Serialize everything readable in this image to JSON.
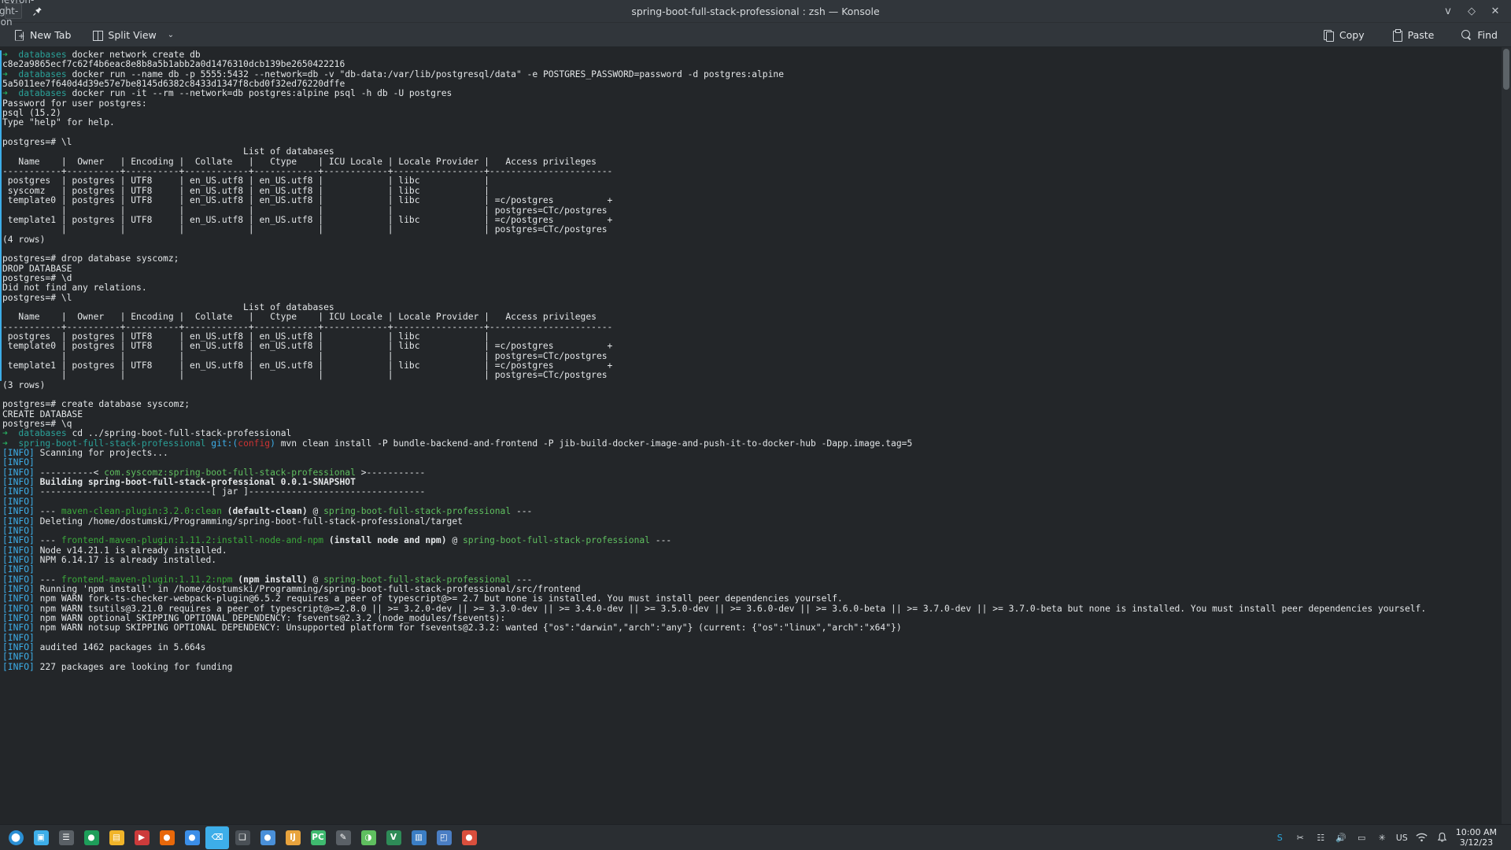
{
  "window": {
    "title": "spring-boot-full-stack-professional : zsh — Konsole",
    "menu_icon": "chevron-right-icon",
    "pin_icon": "pin-icon",
    "minimize_icon": "v",
    "maximize_icon": "◇",
    "close_icon": "✕"
  },
  "toolbar": {
    "new_tab": "New Tab",
    "split_view": "Split View",
    "split_chevron": "⌄",
    "copy": "Copy",
    "paste": "Paste",
    "find": "Find"
  },
  "terminal": {
    "lines": [
      [
        {
          "t": "➜ ",
          "c": "c-grn"
        },
        {
          "t": " databases ",
          "c": "c-cyan"
        },
        {
          "t": "docker network create db",
          "c": "c-w"
        }
      ],
      [
        {
          "t": "c8e2a9865ecf7c62f4b6eac8e8b8a5b1abb2a0d1476310dcb139be2650422216",
          "c": "c-w"
        }
      ],
      [
        {
          "t": "➜ ",
          "c": "c-grn"
        },
        {
          "t": " databases ",
          "c": "c-cyan"
        },
        {
          "t": "docker run --name db -p 5555:5432 --network=db -v \"db-data:/var/lib/postgresql/data\" -e POSTGRES_PASSWORD=password -d postgres:alpine",
          "c": "c-w"
        }
      ],
      [
        {
          "t": "5a5011ee7f640d4d39e57e7be8145d6382c8433d1347f8cbd0f32ed76220dffe",
          "c": "c-w"
        }
      ],
      [
        {
          "t": "➜ ",
          "c": "c-grn"
        },
        {
          "t": " databases ",
          "c": "c-cyan"
        },
        {
          "t": "docker run -it --rm --network=db postgres:alpine psql -h db -U postgres",
          "c": "c-w"
        }
      ],
      [
        {
          "t": "Password for user postgres:",
          "c": "c-w"
        }
      ],
      [
        {
          "t": "psql (15.2)",
          "c": "c-w"
        }
      ],
      [
        {
          "t": "Type \"help\" for help.",
          "c": "c-w"
        }
      ],
      [
        {
          "t": "",
          "c": "c-w"
        }
      ],
      [
        {
          "t": "postgres=# \\l",
          "c": "c-w"
        }
      ],
      [
        {
          "t": "                                             List of databases",
          "c": "c-w"
        }
      ],
      [
        {
          "t": "   Name    |  Owner   | Encoding |  Collate   |   Ctype    | ICU Locale | Locale Provider |   Access privileges",
          "c": "c-w"
        }
      ],
      [
        {
          "t": "-----------+----------+----------+------------+------------+------------+-----------------+-----------------------",
          "c": "c-w"
        }
      ],
      [
        {
          "t": " postgres  | postgres | UTF8     | en_US.utf8 | en_US.utf8 |            | libc            |",
          "c": "c-w"
        }
      ],
      [
        {
          "t": " syscomz   | postgres | UTF8     | en_US.utf8 | en_US.utf8 |            | libc            |",
          "c": "c-w"
        }
      ],
      [
        {
          "t": " template0 | postgres | UTF8     | en_US.utf8 | en_US.utf8 |            | libc            | =c/postgres          +",
          "c": "c-w"
        }
      ],
      [
        {
          "t": "           |          |          |            |            |            |                 | postgres=CTc/postgres",
          "c": "c-w"
        }
      ],
      [
        {
          "t": " template1 | postgres | UTF8     | en_US.utf8 | en_US.utf8 |            | libc            | =c/postgres          +",
          "c": "c-w"
        }
      ],
      [
        {
          "t": "           |          |          |            |            |            |                 | postgres=CTc/postgres",
          "c": "c-w"
        }
      ],
      [
        {
          "t": "(4 rows)",
          "c": "c-w"
        }
      ],
      [
        {
          "t": "",
          "c": "c-w"
        }
      ],
      [
        {
          "t": "postgres=# drop database syscomz;",
          "c": "c-w"
        }
      ],
      [
        {
          "t": "DROP DATABASE",
          "c": "c-w"
        }
      ],
      [
        {
          "t": "postgres=# \\d",
          "c": "c-w"
        }
      ],
      [
        {
          "t": "Did not find any relations.",
          "c": "c-w"
        }
      ],
      [
        {
          "t": "postgres=# \\l",
          "c": "c-w"
        }
      ],
      [
        {
          "t": "                                             List of databases",
          "c": "c-w"
        }
      ],
      [
        {
          "t": "   Name    |  Owner   | Encoding |  Collate   |   Ctype    | ICU Locale | Locale Provider |   Access privileges",
          "c": "c-w"
        }
      ],
      [
        {
          "t": "-----------+----------+----------+------------+------------+------------+-----------------+-----------------------",
          "c": "c-w"
        }
      ],
      [
        {
          "t": " postgres  | postgres | UTF8     | en_US.utf8 | en_US.utf8 |            | libc            |",
          "c": "c-w"
        }
      ],
      [
        {
          "t": " template0 | postgres | UTF8     | en_US.utf8 | en_US.utf8 |            | libc            | =c/postgres          +",
          "c": "c-w"
        }
      ],
      [
        {
          "t": "           |          |          |            |            |            |                 | postgres=CTc/postgres",
          "c": "c-w"
        }
      ],
      [
        {
          "t": " template1 | postgres | UTF8     | en_US.utf8 | en_US.utf8 |            | libc            | =c/postgres          +",
          "c": "c-w"
        }
      ],
      [
        {
          "t": "           |          |          |            |            |            |                 | postgres=CTc/postgres",
          "c": "c-w"
        }
      ],
      [
        {
          "t": "(3 rows)",
          "c": "c-w"
        }
      ],
      [
        {
          "t": "",
          "c": "c-w"
        }
      ],
      [
        {
          "t": "postgres=# create database syscomz;",
          "c": "c-w"
        }
      ],
      [
        {
          "t": "CREATE DATABASE",
          "c": "c-w"
        }
      ],
      [
        {
          "t": "postgres=# \u001f\\q",
          "c": "c-w"
        }
      ],
      [
        {
          "t": "➜ ",
          "c": "c-grn"
        },
        {
          "t": " databases ",
          "c": "c-cyan"
        },
        {
          "t": "cd ../spring-boot-full-stack-professional",
          "c": "c-w"
        }
      ],
      [
        {
          "t": "➜ ",
          "c": "c-grn"
        },
        {
          "t": " spring-boot-full-stack-professional ",
          "c": "c-cyan"
        },
        {
          "t": "git:(",
          "c": "c-blue"
        },
        {
          "t": "config",
          "c": "c-red"
        },
        {
          "t": ") ",
          "c": "c-blue"
        },
        {
          "t": "mvn clean install -P bundle-backend-and-frontend -P jib-build-docker-image-and-push-it-to-docker-hub -Dapp.image.tag=5",
          "c": "c-w"
        }
      ],
      [
        {
          "t": "[INFO]",
          "c": "c-blue"
        },
        {
          "t": " Scanning for projects...",
          "c": "c-w"
        }
      ],
      [
        {
          "t": "[INFO]",
          "c": "c-blue"
        },
        {
          "t": "",
          "c": "c-w"
        }
      ],
      [
        {
          "t": "[INFO]",
          "c": "c-blue"
        },
        {
          "t": " ----------< ",
          "c": "c-w"
        },
        {
          "t": "com.syscomz:spring-boot-full-stack-professional",
          "c": "c-gr3"
        },
        {
          "t": " >-----------",
          "c": "c-w"
        }
      ],
      [
        {
          "t": "[INFO]",
          "c": "c-blue"
        },
        {
          "t": " Building spring-boot-full-stack-professional 0.0.1-SNAPSHOT",
          "c": "c-w bold"
        }
      ],
      [
        {
          "t": "[INFO]",
          "c": "c-blue"
        },
        {
          "t": " --------------------------------[ jar ]---------------------------------",
          "c": "c-w"
        }
      ],
      [
        {
          "t": "[INFO]",
          "c": "c-blue"
        },
        {
          "t": "",
          "c": "c-w"
        }
      ],
      [
        {
          "t": "[INFO]",
          "c": "c-blue"
        },
        {
          "t": " --- ",
          "c": "c-w"
        },
        {
          "t": "maven-clean-plugin:3.2.0:clean",
          "c": "c-gr2"
        },
        {
          "t": " (default-clean)",
          "c": "c-w bold"
        },
        {
          "t": " @ ",
          "c": "c-w"
        },
        {
          "t": "spring-boot-full-stack-professional",
          "c": "c-gr3"
        },
        {
          "t": " ---",
          "c": "c-w"
        }
      ],
      [
        {
          "t": "[INFO]",
          "c": "c-blue"
        },
        {
          "t": " Deleting /home/dostumski/Programming/spring-boot-full-stack-professional/target",
          "c": "c-w"
        }
      ],
      [
        {
          "t": "[INFO]",
          "c": "c-blue"
        },
        {
          "t": "",
          "c": "c-w"
        }
      ],
      [
        {
          "t": "[INFO]",
          "c": "c-blue"
        },
        {
          "t": " --- ",
          "c": "c-w"
        },
        {
          "t": "frontend-maven-plugin:1.11.2:install-node-and-npm",
          "c": "c-gr2"
        },
        {
          "t": " (install node and npm)",
          "c": "c-w bold"
        },
        {
          "t": " @ ",
          "c": "c-w"
        },
        {
          "t": "spring-boot-full-stack-professional",
          "c": "c-gr3"
        },
        {
          "t": " ---",
          "c": "c-w"
        }
      ],
      [
        {
          "t": "[INFO]",
          "c": "c-blue"
        },
        {
          "t": " Node v14.21.1 is already installed.",
          "c": "c-w"
        }
      ],
      [
        {
          "t": "[INFO]",
          "c": "c-blue"
        },
        {
          "t": " NPM 6.14.17 is already installed.",
          "c": "c-w"
        }
      ],
      [
        {
          "t": "[INFO]",
          "c": "c-blue"
        },
        {
          "t": "",
          "c": "c-w"
        }
      ],
      [
        {
          "t": "[INFO]",
          "c": "c-blue"
        },
        {
          "t": " --- ",
          "c": "c-w"
        },
        {
          "t": "frontend-maven-plugin:1.11.2:npm",
          "c": "c-gr2"
        },
        {
          "t": " (npm install)",
          "c": "c-w bold"
        },
        {
          "t": " @ ",
          "c": "c-w"
        },
        {
          "t": "spring-boot-full-stack-professional",
          "c": "c-gr3"
        },
        {
          "t": " ---",
          "c": "c-w"
        }
      ],
      [
        {
          "t": "[INFO]",
          "c": "c-blue"
        },
        {
          "t": " Running 'npm install' in /home/dostumski/Programming/spring-boot-full-stack-professional/src/frontend",
          "c": "c-w"
        }
      ],
      [
        {
          "t": "[INFO]",
          "c": "c-blue"
        },
        {
          "t": " npm WARN fork-ts-checker-webpack-plugin@6.5.2 requires a peer of typescript@>= 2.7 but none is installed. You must install peer dependencies yourself.",
          "c": "c-w"
        }
      ],
      [
        {
          "t": "[INFO]",
          "c": "c-blue"
        },
        {
          "t": " npm WARN tsutils@3.21.0 requires a peer of typescript@>=2.8.0 || >= 3.2.0-dev || >= 3.3.0-dev || >= 3.4.0-dev || >= 3.5.0-dev || >= 3.6.0-dev || >= 3.6.0-beta || >= 3.7.0-dev || >= 3.7.0-beta but none is installed. You must install peer dependencies yourself.",
          "c": "c-w"
        }
      ],
      [
        {
          "t": "[INFO]",
          "c": "c-blue"
        },
        {
          "t": " npm WARN optional SKIPPING OPTIONAL DEPENDENCY: fsevents@2.3.2 (node_modules/fsevents):",
          "c": "c-w"
        }
      ],
      [
        {
          "t": "[INFO]",
          "c": "c-blue"
        },
        {
          "t": " npm WARN notsup SKIPPING OPTIONAL DEPENDENCY: Unsupported platform for fsevents@2.3.2: wanted {\"os\":\"darwin\",\"arch\":\"any\"} (current: {\"os\":\"linux\",\"arch\":\"x64\"})",
          "c": "c-w"
        }
      ],
      [
        {
          "t": "[INFO]",
          "c": "c-blue"
        },
        {
          "t": "",
          "c": "c-w"
        }
      ],
      [
        {
          "t": "[INFO]",
          "c": "c-blue"
        },
        {
          "t": " audited 1462 packages in 5.664s",
          "c": "c-w"
        }
      ],
      [
        {
          "t": "[INFO]",
          "c": "c-blue"
        },
        {
          "t": "",
          "c": "c-w"
        }
      ],
      [
        {
          "t": "[INFO]",
          "c": "c-blue"
        },
        {
          "t": " 227 packages are looking for funding",
          "c": "c-w"
        }
      ]
    ]
  },
  "taskbar": {
    "launcher": {
      "name": "application-launcher",
      "glyph": "⬤",
      "color": "#2a8fd4"
    },
    "items": [
      {
        "name": "pager",
        "glyph": "▣",
        "color": "#3daee9"
      },
      {
        "name": "file-manager",
        "glyph": "☰",
        "color": "#5a6066"
      },
      {
        "name": "web-browser",
        "glyph": "●",
        "color": "#1e9e5a"
      },
      {
        "name": "file-explorer",
        "glyph": "▤",
        "color": "#f0b429"
      },
      {
        "name": "media-player",
        "glyph": "▶",
        "color": "#cc3b3b"
      },
      {
        "name": "firefox",
        "glyph": "●",
        "color": "#e8680a"
      },
      {
        "name": "chrome",
        "glyph": "●",
        "color": "#3b8ee8"
      },
      {
        "name": "konsole",
        "glyph": "⌫",
        "color": "#3daee9"
      },
      {
        "name": "window-list",
        "glyph": "❑",
        "color": "#4a5056"
      },
      {
        "name": "chromium",
        "glyph": "●",
        "color": "#4a90d9"
      },
      {
        "name": "intellij-idea",
        "glyph": "IJ",
        "color": "#e8a33d"
      },
      {
        "name": "pycharm",
        "glyph": "PC",
        "color": "#3fba6f"
      },
      {
        "name": "text-editor",
        "glyph": "✎",
        "color": "#5a6066"
      },
      {
        "name": "node-app",
        "glyph": "◑",
        "color": "#5fbf5f"
      },
      {
        "name": "vim",
        "glyph": "V",
        "color": "#2e8b57"
      },
      {
        "name": "database-tool",
        "glyph": "▥",
        "color": "#3b7ec4"
      },
      {
        "name": "charts-app",
        "glyph": "◰",
        "color": "#4a7ec4"
      },
      {
        "name": "browser-alt",
        "glyph": "●",
        "color": "#d94f3d"
      }
    ],
    "tray": [
      {
        "name": "skype-tray-icon",
        "glyph": "S",
        "color": "#2aa9e0"
      },
      {
        "name": "clipboard-tray-icon",
        "glyph": "✂",
        "color": "#d2d7db"
      },
      {
        "name": "notes-tray-icon",
        "glyph": "☷",
        "color": "#d2d7db"
      },
      {
        "name": "volume-tray-icon",
        "glyph": "🔊",
        "color": "#d2d7db"
      },
      {
        "name": "battery-tray-icon",
        "glyph": "▭",
        "color": "#d2d7db"
      },
      {
        "name": "bluetooth-tray-icon",
        "glyph": "✳",
        "color": "#d2d7db"
      }
    ],
    "keyboard_layout": "US",
    "network_icon": "wifi-icon",
    "notifications_icon": "bell-icon",
    "clock_time": "10:00 AM",
    "clock_date": "3/12/23"
  }
}
